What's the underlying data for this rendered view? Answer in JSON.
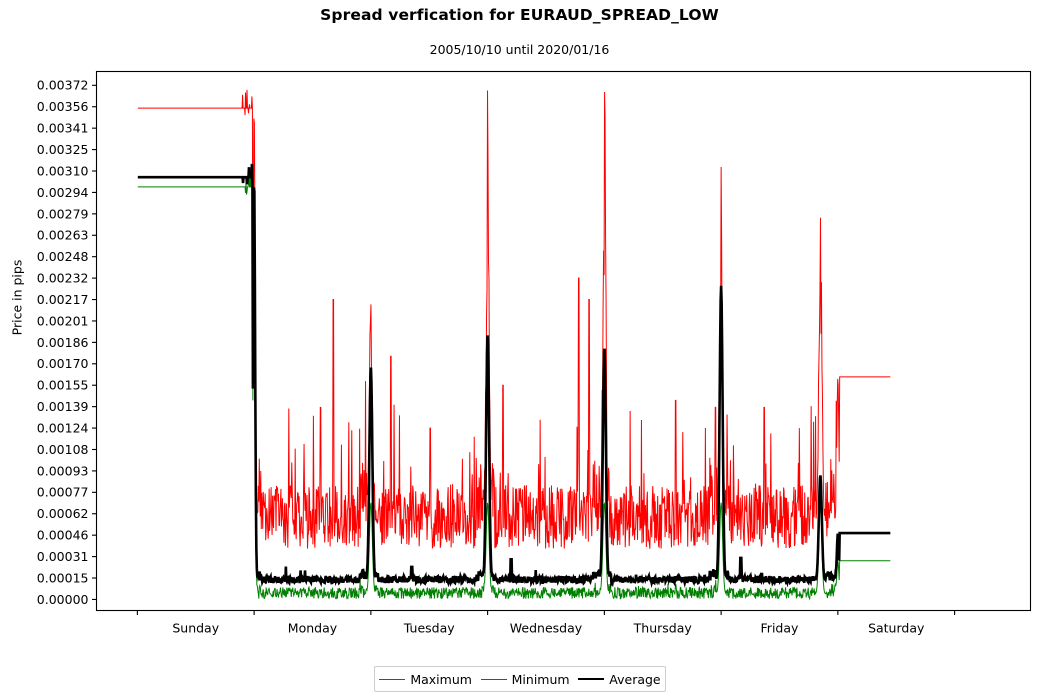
{
  "chart_data": {
    "type": "line",
    "title": "Spread verfication for EURAUD_SPREAD_LOW",
    "subtitle": "2005/10/10 until 2020/01/16",
    "xlabel": "",
    "ylabel": "Price in pips",
    "legend_position": "bottom-center",
    "grid": false,
    "xlim": [
      0,
      8
    ],
    "ylim": [
      -8e-05,
      0.00382
    ],
    "y_ticks": [
      "0.00000",
      "0.00015",
      "0.00031",
      "0.00046",
      "0.00062",
      "0.00077",
      "0.00093",
      "0.00108",
      "0.00124",
      "0.00139",
      "0.00155",
      "0.00170",
      "0.00186",
      "0.00201",
      "0.00217",
      "0.00232",
      "0.00248",
      "0.00263",
      "0.00279",
      "0.00294",
      "0.00310",
      "0.00325",
      "0.00341",
      "0.00356",
      "0.00372"
    ],
    "y_tick_values": [
      0.0,
      0.000155,
      0.00031,
      0.000465,
      0.00062,
      0.000775,
      0.00093,
      0.001085,
      0.00124,
      0.001395,
      0.00155,
      0.001705,
      0.00186,
      0.002015,
      0.00217,
      0.002325,
      0.00248,
      0.002635,
      0.00279,
      0.002945,
      0.0031,
      0.003255,
      0.00341,
      0.003565,
      0.00372
    ],
    "x_tick_labels": [
      "Sunday",
      "Monday",
      "Tuesday",
      "Wednesday",
      "Thursday",
      "Friday",
      "Saturday"
    ],
    "colors": {
      "maximum": "#ff0000",
      "minimum": "#008000",
      "average": "#000000",
      "axes": "#000000",
      "background": "#ffffff"
    },
    "series": [
      {
        "name": "Maximum",
        "color": "#ff0000",
        "width": 1.0,
        "weekend_start_level": 0.003555,
        "weekend_end_level": 0.00161,
        "active_baseline": 0.00056,
        "active_noise": 0.00023,
        "active_spike_prob": 0.055,
        "active_spike_max": 0.00085,
        "midnight_peaks": [
          0.00217,
          0.00347,
          0.003565,
          0.00296,
          0.0031
        ]
      },
      {
        "name": "Minimum",
        "color": "#008000",
        "width": 1.0,
        "weekend_start_level": 0.002985,
        "weekend_end_level": 0.00028,
        "active_baseline": 4e-05,
        "active_noise": 4.2e-05,
        "active_spike_prob": 0.02,
        "active_spike_max": 9e-05,
        "midnight_peaks": [
          0.0007,
          0.0007,
          0.0007,
          0.0007,
          0.0007
        ]
      },
      {
        "name": "Average",
        "color": "#000000",
        "width": 2.6,
        "weekend_start_level": 0.003055,
        "weekend_end_level": 0.00048,
        "active_baseline": 0.00014,
        "active_noise": 2.6e-05,
        "active_spike_prob": 0.012,
        "active_spike_max": 0.00011,
        "midnight_peaks": [
          0.00168,
          0.001915,
          0.00183,
          0.00227,
          0.0009
        ]
      }
    ],
    "session_boundaries": {
      "weekend_close_x": 1.35,
      "weekend_open_x": 6.35,
      "midnight_xs": [
        2.35,
        3.35,
        4.35,
        5.35,
        6.2
      ]
    }
  },
  "legend": {
    "items": [
      {
        "label": "Maximum",
        "style": "max"
      },
      {
        "label": "Minimum",
        "style": "min"
      },
      {
        "label": "Average",
        "style": "avg"
      }
    ]
  }
}
